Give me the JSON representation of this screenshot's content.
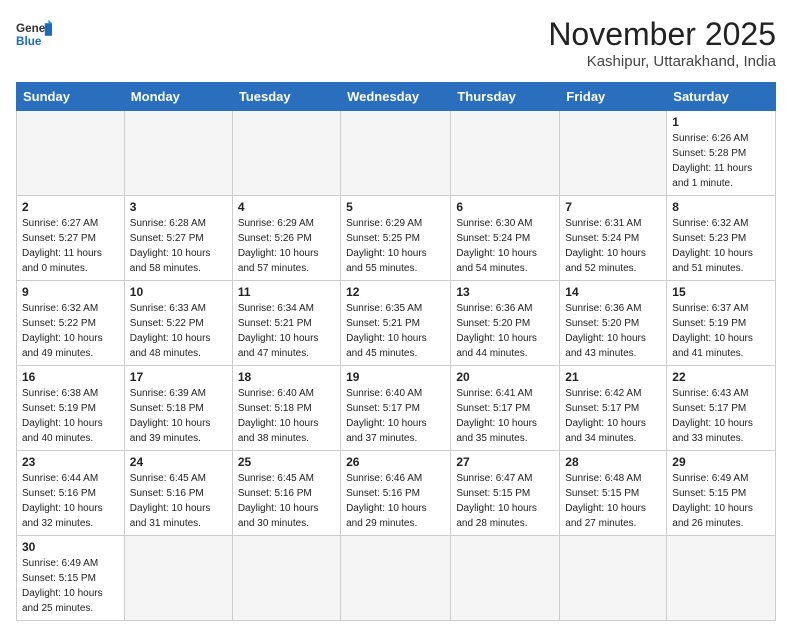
{
  "logo": {
    "text_general": "General",
    "text_blue": "Blue"
  },
  "header": {
    "month": "November 2025",
    "location": "Kashipur, Uttarakhand, India"
  },
  "weekdays": [
    "Sunday",
    "Monday",
    "Tuesday",
    "Wednesday",
    "Thursday",
    "Friday",
    "Saturday"
  ],
  "weeks": [
    [
      {
        "day": "",
        "info": ""
      },
      {
        "day": "",
        "info": ""
      },
      {
        "day": "",
        "info": ""
      },
      {
        "day": "",
        "info": ""
      },
      {
        "day": "",
        "info": ""
      },
      {
        "day": "",
        "info": ""
      },
      {
        "day": "1",
        "info": "Sunrise: 6:26 AM\nSunset: 5:28 PM\nDaylight: 11 hours\nand 1 minute."
      }
    ],
    [
      {
        "day": "2",
        "info": "Sunrise: 6:27 AM\nSunset: 5:27 PM\nDaylight: 11 hours\nand 0 minutes."
      },
      {
        "day": "3",
        "info": "Sunrise: 6:28 AM\nSunset: 5:27 PM\nDaylight: 10 hours\nand 58 minutes."
      },
      {
        "day": "4",
        "info": "Sunrise: 6:29 AM\nSunset: 5:26 PM\nDaylight: 10 hours\nand 57 minutes."
      },
      {
        "day": "5",
        "info": "Sunrise: 6:29 AM\nSunset: 5:25 PM\nDaylight: 10 hours\nand 55 minutes."
      },
      {
        "day": "6",
        "info": "Sunrise: 6:30 AM\nSunset: 5:24 PM\nDaylight: 10 hours\nand 54 minutes."
      },
      {
        "day": "7",
        "info": "Sunrise: 6:31 AM\nSunset: 5:24 PM\nDaylight: 10 hours\nand 52 minutes."
      },
      {
        "day": "8",
        "info": "Sunrise: 6:32 AM\nSunset: 5:23 PM\nDaylight: 10 hours\nand 51 minutes."
      }
    ],
    [
      {
        "day": "9",
        "info": "Sunrise: 6:32 AM\nSunset: 5:22 PM\nDaylight: 10 hours\nand 49 minutes."
      },
      {
        "day": "10",
        "info": "Sunrise: 6:33 AM\nSunset: 5:22 PM\nDaylight: 10 hours\nand 48 minutes."
      },
      {
        "day": "11",
        "info": "Sunrise: 6:34 AM\nSunset: 5:21 PM\nDaylight: 10 hours\nand 47 minutes."
      },
      {
        "day": "12",
        "info": "Sunrise: 6:35 AM\nSunset: 5:21 PM\nDaylight: 10 hours\nand 45 minutes."
      },
      {
        "day": "13",
        "info": "Sunrise: 6:36 AM\nSunset: 5:20 PM\nDaylight: 10 hours\nand 44 minutes."
      },
      {
        "day": "14",
        "info": "Sunrise: 6:36 AM\nSunset: 5:20 PM\nDaylight: 10 hours\nand 43 minutes."
      },
      {
        "day": "15",
        "info": "Sunrise: 6:37 AM\nSunset: 5:19 PM\nDaylight: 10 hours\nand 41 minutes."
      }
    ],
    [
      {
        "day": "16",
        "info": "Sunrise: 6:38 AM\nSunset: 5:19 PM\nDaylight: 10 hours\nand 40 minutes."
      },
      {
        "day": "17",
        "info": "Sunrise: 6:39 AM\nSunset: 5:18 PM\nDaylight: 10 hours\nand 39 minutes."
      },
      {
        "day": "18",
        "info": "Sunrise: 6:40 AM\nSunset: 5:18 PM\nDaylight: 10 hours\nand 38 minutes."
      },
      {
        "day": "19",
        "info": "Sunrise: 6:40 AM\nSunset: 5:17 PM\nDaylight: 10 hours\nand 37 minutes."
      },
      {
        "day": "20",
        "info": "Sunrise: 6:41 AM\nSunset: 5:17 PM\nDaylight: 10 hours\nand 35 minutes."
      },
      {
        "day": "21",
        "info": "Sunrise: 6:42 AM\nSunset: 5:17 PM\nDaylight: 10 hours\nand 34 minutes."
      },
      {
        "day": "22",
        "info": "Sunrise: 6:43 AM\nSunset: 5:17 PM\nDaylight: 10 hours\nand 33 minutes."
      }
    ],
    [
      {
        "day": "23",
        "info": "Sunrise: 6:44 AM\nSunset: 5:16 PM\nDaylight: 10 hours\nand 32 minutes."
      },
      {
        "day": "24",
        "info": "Sunrise: 6:45 AM\nSunset: 5:16 PM\nDaylight: 10 hours\nand 31 minutes."
      },
      {
        "day": "25",
        "info": "Sunrise: 6:45 AM\nSunset: 5:16 PM\nDaylight: 10 hours\nand 30 minutes."
      },
      {
        "day": "26",
        "info": "Sunrise: 6:46 AM\nSunset: 5:16 PM\nDaylight: 10 hours\nand 29 minutes."
      },
      {
        "day": "27",
        "info": "Sunrise: 6:47 AM\nSunset: 5:15 PM\nDaylight: 10 hours\nand 28 minutes."
      },
      {
        "day": "28",
        "info": "Sunrise: 6:48 AM\nSunset: 5:15 PM\nDaylight: 10 hours\nand 27 minutes."
      },
      {
        "day": "29",
        "info": "Sunrise: 6:49 AM\nSunset: 5:15 PM\nDaylight: 10 hours\nand 26 minutes."
      }
    ],
    [
      {
        "day": "30",
        "info": "Sunrise: 6:49 AM\nSunset: 5:15 PM\nDaylight: 10 hours\nand 25 minutes."
      },
      {
        "day": "",
        "info": ""
      },
      {
        "day": "",
        "info": ""
      },
      {
        "day": "",
        "info": ""
      },
      {
        "day": "",
        "info": ""
      },
      {
        "day": "",
        "info": ""
      },
      {
        "day": "",
        "info": ""
      }
    ]
  ]
}
